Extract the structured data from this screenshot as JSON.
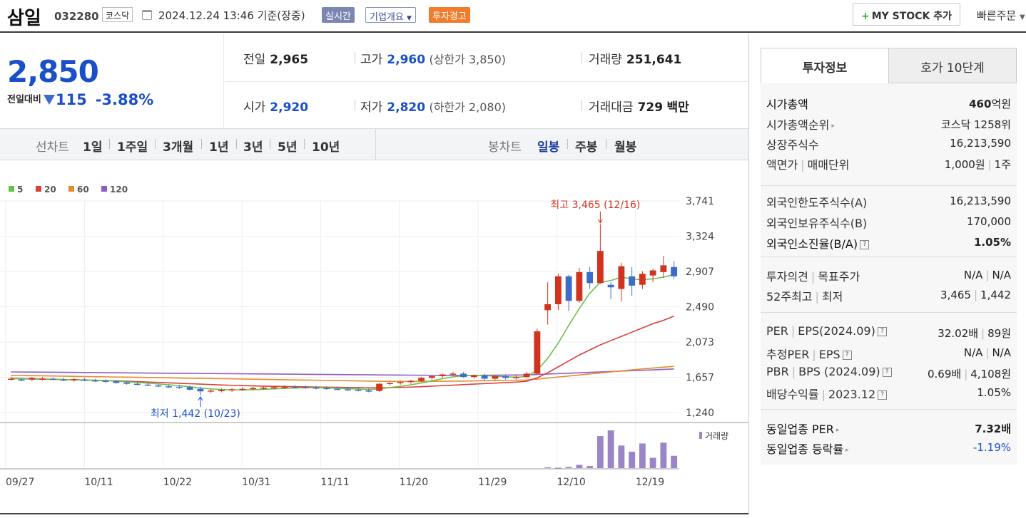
{
  "header": {
    "name": "삼일",
    "code": "032280",
    "market": "코스닥",
    "datetime": "2024.12.24 13:46 기준(장중)",
    "btn_realtime": "실시간",
    "btn_overview": "기업개요",
    "btn_warning": "투자경고",
    "mystock": "MY STOCK 추가",
    "quick_order": "빠른주문"
  },
  "price": {
    "current": "2,850",
    "change_label": "전일대비",
    "change": "115",
    "change_pct": "-3.88%"
  },
  "stats": {
    "prev_label": "전일",
    "prev": "2,965",
    "high_label": "고가",
    "high": "2,960",
    "upper_limit": "(상한가 3,850)",
    "volume_label": "거래량",
    "volume": "251,641",
    "open_label": "시가",
    "open": "2,920",
    "low_label": "저가",
    "low": "2,820",
    "lower_limit": "(하한가 2,080)",
    "amount_label": "거래대금",
    "amount": "729",
    "amount_unit": "백만"
  },
  "chart_tabs": {
    "line_label": "선차트",
    "periods": [
      "1일",
      "1주일",
      "3개월",
      "1년",
      "3년",
      "5년",
      "10년"
    ],
    "candle_label": "봉차트",
    "candles": [
      "일봉",
      "주봉",
      "월봉"
    ]
  },
  "investment": {
    "tab_info": "투자정보",
    "tab_orderbook": "호가 10단계",
    "market_cap_label": "시가총액",
    "market_cap": "460",
    "market_cap_unit": "억원",
    "cap_rank_label": "시가총액순위",
    "cap_rank": "코스닥 1258위",
    "shares_label": "상장주식수",
    "shares": "16,213,590",
    "face_label": "액면가",
    "unit_label": "매매단위",
    "face": "1,000원",
    "unit": "1주",
    "foreign_limit_label": "외국인한도주식수(A)",
    "foreign_limit": "16,213,590",
    "foreign_hold_label": "외국인보유주식수(B)",
    "foreign_hold": "170,000",
    "foreign_ratio_label": "외국인소진율(B/A)",
    "foreign_ratio": "1.05%",
    "opinion_label": "투자의견",
    "target_label": "목표주가",
    "opinion": "N/A",
    "target": "N/A",
    "w52_label": "52주최고",
    "w52_low_label": "최저",
    "w52_high": "3,465",
    "w52_low": "1,442",
    "per_label": "PER",
    "eps_label": "EPS(2024.09)",
    "per": "32.02배",
    "eps": "89원",
    "est_per_label": "추정PER",
    "est_eps_label": "EPS",
    "est_per": "N/A",
    "est_eps": "N/A",
    "pbr_label": "PBR",
    "bps_label": "BPS (2024.09)",
    "pbr": "0.69배",
    "bps": "4,108원",
    "div_label": "배당수익률",
    "div_year": "2023.12",
    "div": "1.05%",
    "ind_per_label": "동일업종 PER",
    "ind_per": "7.32배",
    "ind_chg_label": "동일업종 등락률",
    "ind_chg": "-1.19%"
  },
  "colors": {
    "up": "#d0341f",
    "down": "#3d6cc9",
    "ma5": "#6abf4b",
    "ma20": "#d9423a",
    "ma60": "#e88b2e",
    "ma120": "#8a5ec9",
    "volume": "#9a86c7"
  },
  "chart_data": {
    "type": "candlestick",
    "legend": [
      "5",
      "20",
      "60",
      "120"
    ],
    "y_ticks": [
      3741,
      3324,
      2907,
      2490,
      2073,
      1657,
      1240
    ],
    "x_ticks": [
      "09/27",
      "10/11",
      "10/22",
      "10/31",
      "11/11",
      "11/20",
      "11/29",
      "12/10",
      "12/19"
    ],
    "max_label": "최고 3,465 (12/16)",
    "min_label": "최저 1,442 (10/23)",
    "volume_label": "거래량",
    "ohlc": [
      [
        1640,
        1660,
        1620,
        1640
      ],
      [
        1630,
        1650,
        1610,
        1625
      ],
      [
        1630,
        1660,
        1610,
        1650
      ],
      [
        1640,
        1660,
        1620,
        1640
      ],
      [
        1640,
        1655,
        1625,
        1635
      ],
      [
        1630,
        1650,
        1610,
        1620
      ],
      [
        1625,
        1645,
        1605,
        1635
      ],
      [
        1630,
        1650,
        1610,
        1620
      ],
      [
        1620,
        1640,
        1600,
        1615
      ],
      [
        1615,
        1630,
        1590,
        1610
      ],
      [
        1610,
        1625,
        1580,
        1590
      ],
      [
        1595,
        1610,
        1570,
        1580
      ],
      [
        1580,
        1600,
        1560,
        1570
      ],
      [
        1570,
        1590,
        1555,
        1565
      ],
      [
        1560,
        1580,
        1540,
        1555
      ],
      [
        1550,
        1570,
        1530,
        1545
      ],
      [
        1545,
        1565,
        1520,
        1540
      ],
      [
        1540,
        1560,
        1500,
        1510
      ],
      [
        1520,
        1545,
        1442,
        1490
      ],
      [
        1490,
        1520,
        1470,
        1500
      ],
      [
        1500,
        1525,
        1480,
        1505
      ],
      [
        1505,
        1530,
        1485,
        1515
      ],
      [
        1515,
        1540,
        1495,
        1520
      ],
      [
        1520,
        1545,
        1500,
        1530
      ],
      [
        1530,
        1550,
        1510,
        1535
      ],
      [
        1535,
        1555,
        1515,
        1540
      ],
      [
        1540,
        1560,
        1520,
        1545
      ],
      [
        1545,
        1565,
        1525,
        1540
      ],
      [
        1540,
        1560,
        1520,
        1535
      ],
      [
        1535,
        1555,
        1515,
        1530
      ],
      [
        1530,
        1550,
        1510,
        1520
      ],
      [
        1520,
        1545,
        1505,
        1515
      ],
      [
        1515,
        1540,
        1495,
        1510
      ],
      [
        1510,
        1530,
        1490,
        1500
      ],
      [
        1500,
        1525,
        1480,
        1495
      ],
      [
        1495,
        1590,
        1485,
        1580
      ],
      [
        1580,
        1600,
        1560,
        1590
      ],
      [
        1590,
        1610,
        1570,
        1600
      ],
      [
        1600,
        1625,
        1580,
        1615
      ],
      [
        1615,
        1660,
        1600,
        1650
      ],
      [
        1650,
        1680,
        1630,
        1670
      ],
      [
        1670,
        1700,
        1650,
        1690
      ],
      [
        1690,
        1720,
        1670,
        1700
      ],
      [
        1700,
        1720,
        1650,
        1660
      ],
      [
        1660,
        1690,
        1640,
        1680
      ],
      [
        1680,
        1700,
        1620,
        1640
      ],
      [
        1640,
        1680,
        1620,
        1670
      ],
      [
        1670,
        1690,
        1630,
        1650
      ],
      [
        1650,
        1680,
        1630,
        1660
      ],
      [
        1660,
        1720,
        1650,
        1700
      ],
      [
        1700,
        2230,
        1690,
        2200
      ],
      [
        2450,
        2780,
        2280,
        2520
      ],
      [
        2520,
        2880,
        2450,
        2850
      ],
      [
        2850,
        2870,
        2440,
        2560
      ],
      [
        2560,
        2950,
        2540,
        2900
      ],
      [
        2900,
        2960,
        2700,
        2770
      ],
      [
        2770,
        3465,
        2760,
        3150
      ],
      [
        2750,
        2780,
        2580,
        2720
      ],
      [
        2700,
        3010,
        2550,
        2970
      ],
      [
        2850,
        2960,
        2620,
        2740
      ],
      [
        2750,
        2910,
        2700,
        2880
      ],
      [
        2860,
        2940,
        2780,
        2920
      ],
      [
        2900,
        3090,
        2830,
        2980
      ],
      [
        2960,
        3030,
        2820,
        2850
      ]
    ],
    "ma5": [
      1640,
      1638,
      1636,
      1634,
      1632,
      1630,
      1628,
      1626,
      1622,
      1618,
      1612,
      1604,
      1596,
      1588,
      1578,
      1568,
      1558,
      1545,
      1530,
      1520,
      1512,
      1508,
      1508,
      1510,
      1514,
      1520,
      1526,
      1530,
      1534,
      1535,
      1532,
      1528,
      1524,
      1518,
      1512,
      1520,
      1535,
      1550,
      1568,
      1590,
      1615,
      1640,
      1662,
      1675,
      1680,
      1678,
      1670,
      1662,
      1658,
      1665,
      1740,
      1880,
      2060,
      2270,
      2470,
      2650,
      2780,
      2800,
      2840,
      2820,
      2810,
      2820,
      2840,
      2870
    ],
    "ma20": [
      1645,
      1642,
      1639,
      1636,
      1633,
      1630,
      1627,
      1624,
      1621,
      1618,
      1615,
      1611,
      1606,
      1601,
      1596,
      1591,
      1586,
      1581,
      1576,
      1571,
      1566,
      1562,
      1558,
      1555,
      1552,
      1550,
      1548,
      1546,
      1544,
      1542,
      1540,
      1538,
      1536,
      1534,
      1532,
      1532,
      1534,
      1537,
      1541,
      1546,
      1552,
      1558,
      1564,
      1570,
      1576,
      1582,
      1588,
      1594,
      1600,
      1610,
      1650,
      1710,
      1780,
      1850,
      1920,
      1980,
      2040,
      2090,
      2140,
      2190,
      2240,
      2290,
      2330,
      2380
    ],
    "ma60": [
      1680,
      1678,
      1676,
      1674,
      1672,
      1670,
      1668,
      1666,
      1664,
      1662,
      1660,
      1658,
      1656,
      1654,
      1652,
      1650,
      1648,
      1646,
      1644,
      1642,
      1640,
      1638,
      1636,
      1634,
      1632,
      1630,
      1628,
      1626,
      1624,
      1622,
      1620,
      1618,
      1616,
      1614,
      1612,
      1610,
      1609,
      1608,
      1608,
      1608,
      1609,
      1610,
      1611,
      1612,
      1614,
      1616,
      1618,
      1620,
      1622,
      1625,
      1635,
      1648,
      1660,
      1672,
      1684,
      1696,
      1708,
      1720,
      1732,
      1744,
      1756,
      1766,
      1776,
      1786
    ],
    "ma120": [
      1720,
      1719,
      1718,
      1717,
      1716,
      1715,
      1714,
      1713,
      1712,
      1711,
      1710,
      1709,
      1708,
      1707,
      1706,
      1705,
      1704,
      1703,
      1702,
      1701,
      1700,
      1699,
      1698,
      1697,
      1696,
      1695,
      1694,
      1693,
      1692,
      1691,
      1690,
      1689,
      1688,
      1687,
      1686,
      1685,
      1684,
      1683,
      1682,
      1681,
      1680,
      1680,
      1680,
      1680,
      1680,
      1681,
      1682,
      1683,
      1684,
      1685,
      1690,
      1695,
      1700,
      1705,
      1710,
      1715,
      1720,
      1725,
      1730,
      1735,
      1740,
      1745,
      1750,
      1755
    ],
    "volume": [
      0,
      0,
      0,
      0,
      0,
      0,
      0,
      0,
      0,
      0,
      0,
      0,
      0,
      0,
      0,
      0,
      0,
      0,
      0,
      0,
      0,
      0,
      0,
      0,
      0,
      0,
      0,
      0,
      0,
      0,
      0,
      0,
      0,
      0,
      0,
      0,
      0,
      0,
      0,
      0,
      0,
      0,
      0,
      0,
      0,
      0,
      0,
      0,
      0,
      0,
      0,
      2,
      1,
      3,
      8,
      5,
      78,
      92,
      55,
      40,
      60,
      25,
      62,
      30
    ]
  }
}
